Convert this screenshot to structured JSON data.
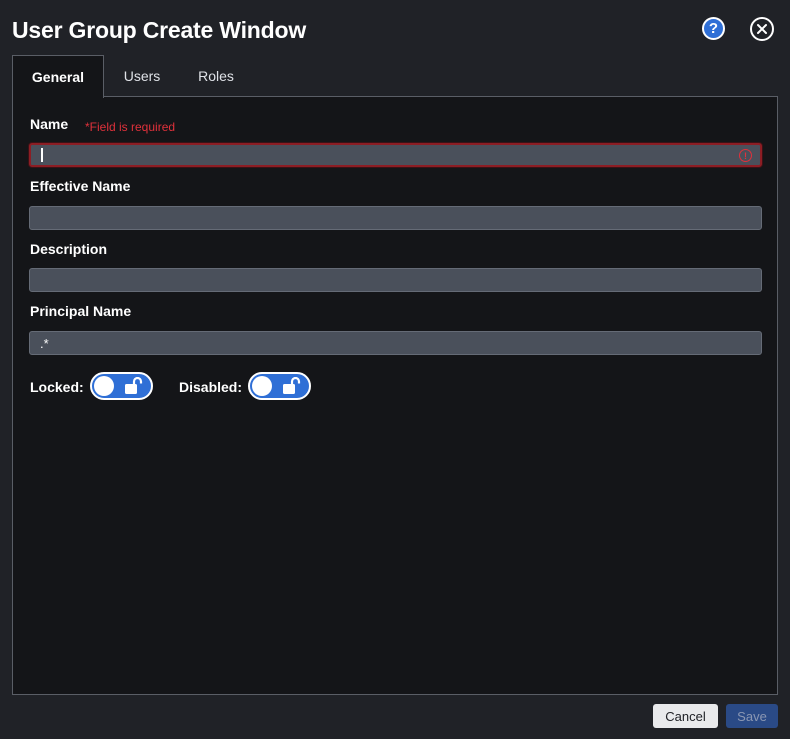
{
  "window": {
    "title": "User Group Create Window",
    "help_label": "?"
  },
  "tabs": [
    {
      "label": "General",
      "active": true
    },
    {
      "label": "Users",
      "active": false
    },
    {
      "label": "Roles",
      "active": false
    }
  ],
  "form": {
    "name": {
      "label": "Name",
      "required_text": "*Field is required",
      "value": "",
      "error_icon": "!"
    },
    "effective_name": {
      "label": "Effective Name",
      "value": ""
    },
    "description": {
      "label": "Description",
      "value": ""
    },
    "principal_name": {
      "label": "Principal Name",
      "value": ".*"
    },
    "locked": {
      "label": "Locked:",
      "state": "unlocked-icon"
    },
    "disabled": {
      "label": "Disabled:",
      "state": "unlocked-icon"
    }
  },
  "footer": {
    "cancel_label": "Cancel",
    "save_label": "Save"
  },
  "colors": {
    "accent": "#2f6fd6",
    "error": "#e0313b",
    "background": "#202227",
    "panel": "#141518",
    "input": "#4a505b"
  }
}
